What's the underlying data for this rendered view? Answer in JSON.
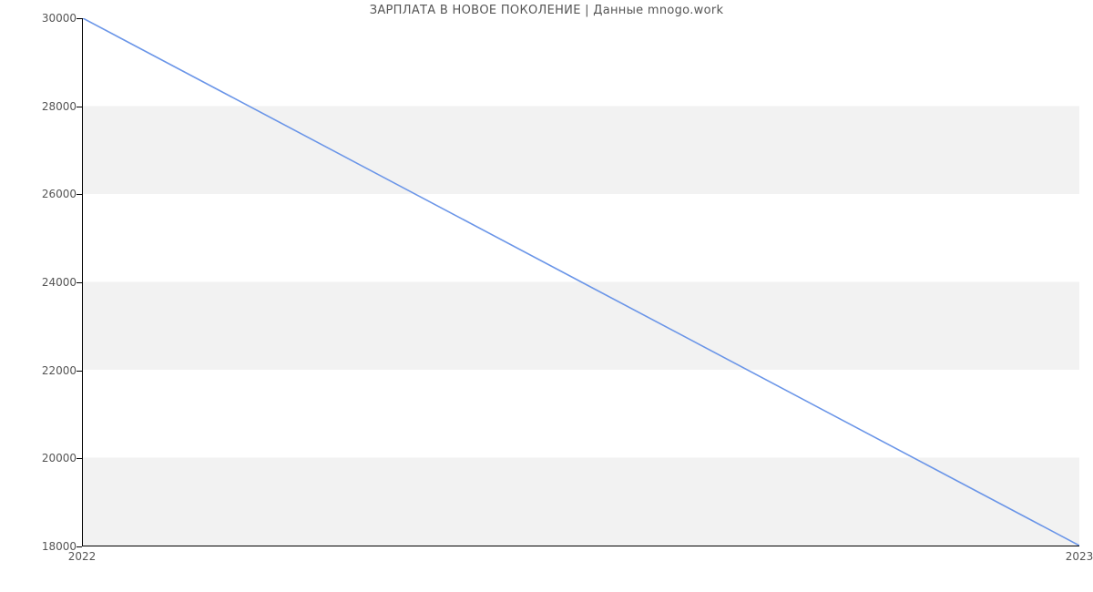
{
  "chart_data": {
    "type": "line",
    "title": "ЗАРПЛАТА В  НОВОЕ ПОКОЛЕНИЕ | Данные mnogo.work",
    "x": [
      2022,
      2023
    ],
    "y": [
      30000,
      18000
    ],
    "xlabel": "",
    "ylabel": "",
    "xlim": [
      2022,
      2023
    ],
    "ylim": [
      18000,
      30000
    ],
    "xticks": [
      2022,
      2023
    ],
    "yticks": [
      18000,
      20000,
      22000,
      24000,
      26000,
      28000,
      30000
    ],
    "line_color": "#6a95e8",
    "band_color": "#f2f2f2"
  }
}
